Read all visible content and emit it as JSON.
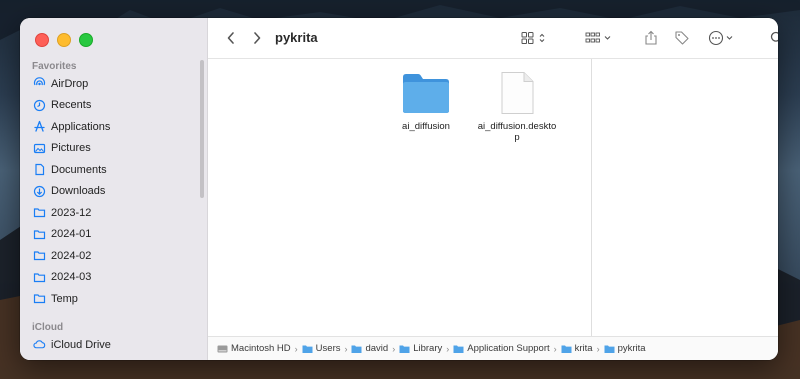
{
  "window": {
    "title": "pykrita"
  },
  "sidebar": {
    "favorites_label": "Favorites",
    "favorites": [
      {
        "label": "AirDrop",
        "icon": "airdrop-icon"
      },
      {
        "label": "Recents",
        "icon": "clock-icon"
      },
      {
        "label": "Applications",
        "icon": "applications-icon"
      },
      {
        "label": "Pictures",
        "icon": "photo-icon"
      },
      {
        "label": "Documents",
        "icon": "document-icon"
      },
      {
        "label": "Downloads",
        "icon": "download-icon"
      },
      {
        "label": "2023-12",
        "icon": "folder-icon"
      },
      {
        "label": "2024-01",
        "icon": "folder-icon"
      },
      {
        "label": "2024-02",
        "icon": "folder-icon"
      },
      {
        "label": "2024-03",
        "icon": "folder-icon"
      },
      {
        "label": "Temp",
        "icon": "folder-icon"
      }
    ],
    "icloud_label": "iCloud",
    "icloud": [
      {
        "label": "iCloud Drive",
        "icon": "cloud-icon"
      }
    ]
  },
  "files": [
    {
      "name": "ai_diffusion",
      "kind": "folder"
    },
    {
      "name": "ai_diffusion.desktop",
      "kind": "document"
    }
  ],
  "path": [
    {
      "label": "Macintosh HD",
      "icon": "disk-icon"
    },
    {
      "label": "Users",
      "icon": "folder-icon"
    },
    {
      "label": "david",
      "icon": "folder-icon"
    },
    {
      "label": "Library",
      "icon": "folder-icon"
    },
    {
      "label": "Application Support",
      "icon": "folder-icon"
    },
    {
      "label": "krita",
      "icon": "folder-icon"
    },
    {
      "label": "pykrita",
      "icon": "folder-icon"
    }
  ],
  "colors": {
    "accent": "#1a7ef5",
    "folder": "#4fa3e8"
  }
}
